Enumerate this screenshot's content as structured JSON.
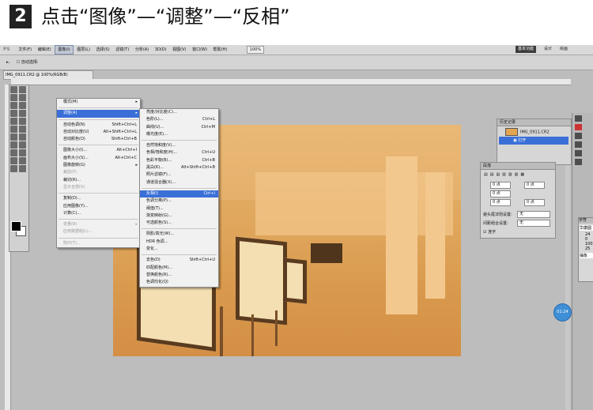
{
  "header": {
    "step_number": "2",
    "title": "点击“图像”—“调整”—“反相”"
  },
  "app": {
    "logo": "PS",
    "menus": [
      "文件(F)",
      "编辑(E)",
      "图像(I)",
      "图层(L)",
      "选择(S)",
      "滤镜(T)",
      "分析(A)",
      "3D(D)",
      "视图(V)",
      "窗口(W)",
      "帮助(H)"
    ],
    "zoom_select": "100%",
    "workspace_buttons": [
      "基本功能",
      "设计",
      "绘画"
    ],
    "options_bar": {
      "auto_select_label": "自动选择:"
    },
    "doc_tab": "IMG_0911.CR2 @ 100%(RGB/8)"
  },
  "image_menu": {
    "items": [
      {
        "label": "模式(M)",
        "shortcut": "",
        "submenu": true,
        "state": "normal"
      },
      {
        "sep": true
      },
      {
        "label": "调整(A)",
        "shortcut": "",
        "submenu": true,
        "state": "highlight"
      },
      {
        "sep": true
      },
      {
        "label": "自动色调(N)",
        "shortcut": "Shift+Ctrl+L",
        "state": "normal"
      },
      {
        "label": "自动对比度(U)",
        "shortcut": "Alt+Shift+Ctrl+L",
        "state": "normal"
      },
      {
        "label": "自动颜色(O)",
        "shortcut": "Shift+Ctrl+B",
        "state": "normal"
      },
      {
        "sep": true
      },
      {
        "label": "图像大小(I)...",
        "shortcut": "Alt+Ctrl+I",
        "state": "normal"
      },
      {
        "label": "画布大小(S)...",
        "shortcut": "Alt+Ctrl+C",
        "state": "normal"
      },
      {
        "label": "图像旋转(G)",
        "shortcut": "",
        "submenu": true,
        "state": "normal"
      },
      {
        "label": "裁剪(P)",
        "shortcut": "",
        "state": "disabled"
      },
      {
        "label": "裁切(R)...",
        "shortcut": "",
        "state": "normal"
      },
      {
        "label": "显示全部(V)",
        "shortcut": "",
        "state": "disabled"
      },
      {
        "sep": true
      },
      {
        "label": "复制(D)...",
        "shortcut": "",
        "state": "normal"
      },
      {
        "label": "应用图像(Y)...",
        "shortcut": "",
        "state": "normal"
      },
      {
        "label": "计算(C)...",
        "shortcut": "",
        "state": "normal"
      },
      {
        "sep": true
      },
      {
        "label": "变量(B)",
        "shortcut": "",
        "submenu": true,
        "state": "disabled"
      },
      {
        "label": "应用数据组(L)...",
        "shortcut": "",
        "state": "disabled"
      },
      {
        "sep": true
      },
      {
        "label": "陷印(T)...",
        "shortcut": "",
        "state": "disabled"
      }
    ]
  },
  "adjust_menu": {
    "items": [
      {
        "label": "亮度/对比度(C)...",
        "shortcut": "",
        "state": "normal"
      },
      {
        "label": "色阶(L)...",
        "shortcut": "Ctrl+L",
        "state": "normal"
      },
      {
        "label": "曲线(U)...",
        "shortcut": "Ctrl+M",
        "state": "normal"
      },
      {
        "label": "曝光度(E)...",
        "shortcut": "",
        "state": "normal"
      },
      {
        "sep": true
      },
      {
        "label": "自然饱和度(V)...",
        "shortcut": "",
        "state": "normal"
      },
      {
        "label": "色相/饱和度(H)...",
        "shortcut": "Ctrl+U",
        "state": "normal"
      },
      {
        "label": "色彩平衡(B)...",
        "shortcut": "Ctrl+B",
        "state": "normal"
      },
      {
        "label": "黑白(K)...",
        "shortcut": "Alt+Shift+Ctrl+B",
        "state": "normal"
      },
      {
        "label": "照片滤镜(F)...",
        "shortcut": "",
        "state": "normal"
      },
      {
        "label": "通道混合器(X)...",
        "shortcut": "",
        "state": "normal"
      },
      {
        "sep": true
      },
      {
        "label": "反相(I)",
        "shortcut": "Ctrl+I",
        "state": "highlight"
      },
      {
        "label": "色调分离(P)...",
        "shortcut": "",
        "state": "normal"
      },
      {
        "label": "阈值(T)...",
        "shortcut": "",
        "state": "normal"
      },
      {
        "label": "渐变映射(G)...",
        "shortcut": "",
        "state": "normal"
      },
      {
        "label": "可选颜色(S)...",
        "shortcut": "",
        "state": "normal"
      },
      {
        "sep": true
      },
      {
        "label": "阴影/高光(W)...",
        "shortcut": "",
        "state": "normal"
      },
      {
        "label": "HDR 色调...",
        "shortcut": "",
        "state": "normal"
      },
      {
        "label": "变化...",
        "shortcut": "",
        "state": "normal"
      },
      {
        "sep": true
      },
      {
        "label": "去色(D)",
        "shortcut": "Shift+Ctrl+U",
        "state": "normal"
      },
      {
        "label": "匹配颜色(M)...",
        "shortcut": "",
        "state": "normal"
      },
      {
        "label": "替换颜色(R)...",
        "shortcut": "",
        "state": "normal"
      },
      {
        "label": "色调均化(Q)",
        "shortcut": "",
        "state": "normal"
      }
    ]
  },
  "history_panel": {
    "tab": "历史记录",
    "items": [
      "IMG_0911.CR2",
      "打开"
    ]
  },
  "paragraph_panel": {
    "tab": "段落",
    "fields": [
      "0 点",
      "0 点",
      "0 点",
      "0 点",
      "0 点"
    ],
    "dropdown1_label": "避头尾法则设置:",
    "dropdown1_value": "无",
    "dropdown2_label": "间距组合设置:",
    "dropdown2_value": "无",
    "hyphen_label": "连字"
  },
  "char_panel": {
    "tab": "字符",
    "font": "华康圆",
    "values": [
      "24",
      "0",
      "100",
      "25"
    ],
    "aa": "抽象"
  },
  "zoom_badge": "01:24"
}
